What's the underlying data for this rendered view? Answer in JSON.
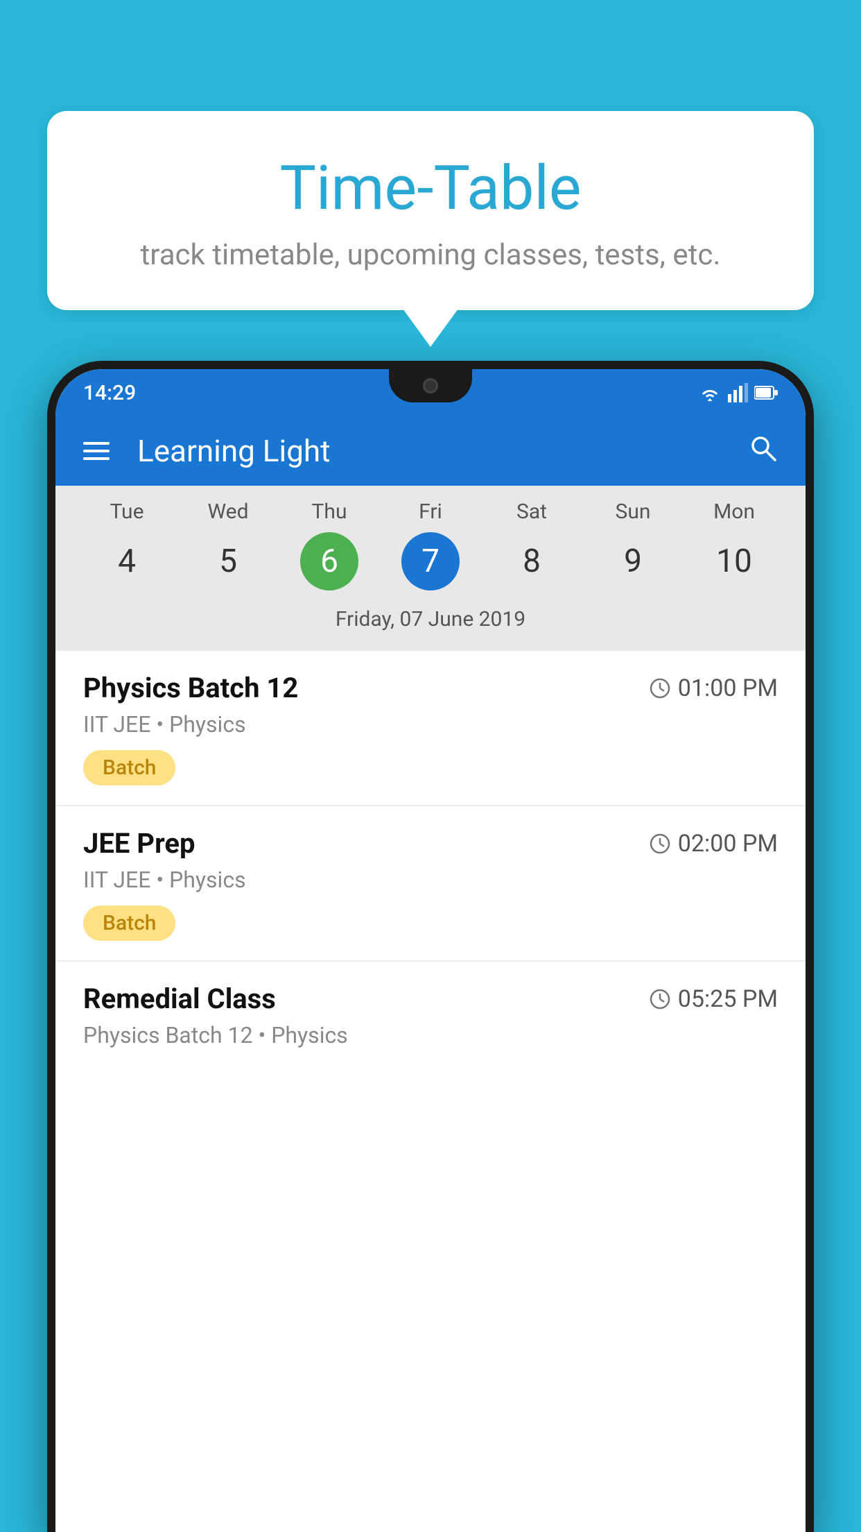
{
  "background_color": "#29b6d8",
  "speech_bubble": {
    "title": "Time-Table",
    "subtitle": "track timetable, upcoming classes, tests, etc."
  },
  "phone": {
    "status_bar": {
      "time": "14:29",
      "icons": [
        "wifi",
        "signal",
        "battery"
      ]
    },
    "app_bar": {
      "title": "Learning Light",
      "menu_label": "menu",
      "search_label": "search"
    },
    "calendar": {
      "days": [
        {
          "name": "Tue",
          "num": "4",
          "state": "normal"
        },
        {
          "name": "Wed",
          "num": "5",
          "state": "normal"
        },
        {
          "name": "Thu",
          "num": "6",
          "state": "today"
        },
        {
          "name": "Fri",
          "num": "7",
          "state": "selected"
        },
        {
          "name": "Sat",
          "num": "8",
          "state": "normal"
        },
        {
          "name": "Sun",
          "num": "9",
          "state": "normal"
        },
        {
          "name": "Mon",
          "num": "10",
          "state": "normal"
        }
      ],
      "selected_date": "Friday, 07 June 2019"
    },
    "classes": [
      {
        "name": "Physics Batch 12",
        "time": "01:00 PM",
        "meta": "IIT JEE • Physics",
        "badge": "Batch"
      },
      {
        "name": "JEE Prep",
        "time": "02:00 PM",
        "meta": "IIT JEE • Physics",
        "badge": "Batch"
      },
      {
        "name": "Remedial Class",
        "time": "05:25 PM",
        "meta": "Physics Batch 12 • Physics",
        "badge": null
      }
    ]
  }
}
